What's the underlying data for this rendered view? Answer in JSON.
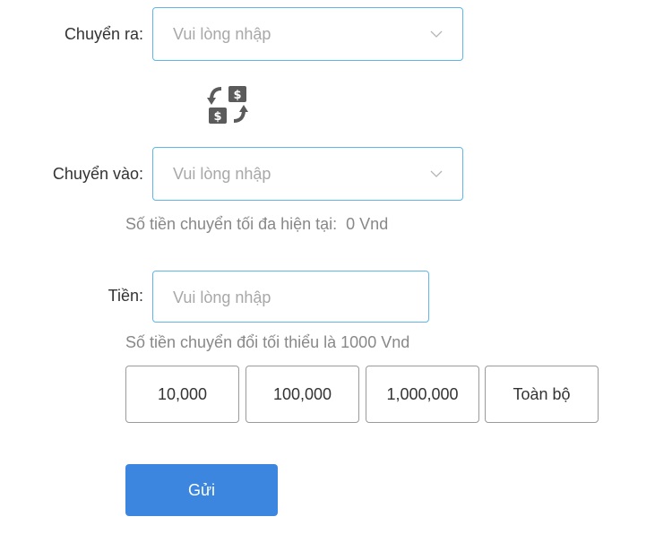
{
  "transfer_out": {
    "label": "Chuyển ra:",
    "placeholder": "Vui lòng nhập"
  },
  "swap_icon": "swap-dollar-icon",
  "transfer_in": {
    "label": "Chuyển vào:",
    "placeholder": "Vui lòng nhập"
  },
  "max_transfer_hint": "Số tiền chuyển tối đa hiện tại:  0 Vnd",
  "amount": {
    "label": "Tiền:",
    "placeholder": "Vui lòng nhập"
  },
  "min_transfer_hint": "Số tiền chuyển đổi tối thiểu là 1000 Vnd",
  "quick_amounts": [
    "10,000",
    "100,000",
    "1,000,000",
    "Toàn bộ"
  ],
  "submit_label": "Gửi",
  "colors": {
    "input_border": "#5eb7e8",
    "submit_bg": "#3d86e0",
    "placeholder": "#a8a8a8",
    "hint": "#888888"
  }
}
